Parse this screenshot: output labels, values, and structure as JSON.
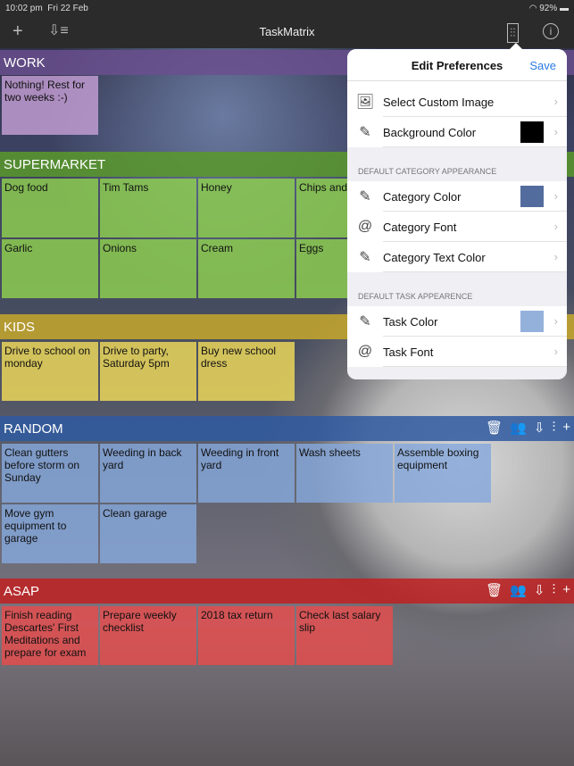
{
  "status": {
    "time": "10:02 pm",
    "date": "Fri 22 Feb",
    "battery": "92%"
  },
  "nav": {
    "title": "TaskMatrix",
    "add_icon": "plus-icon",
    "sort_icon": "sort-icon",
    "prefs_icon": "sliders-icon",
    "info_icon": "info-icon"
  },
  "categories": [
    {
      "name": "WORK",
      "color": "#6a4f8f",
      "task_color": "#c79fd6",
      "tasks": [
        "Nothing! Rest for two weeks :-)"
      ]
    },
    {
      "name": "SUPERMARKET",
      "color": "#5a9a2a",
      "task_color": "#8fd24f",
      "tasks": [
        "Dog food",
        "Tim Tams",
        "Honey",
        "Chips and",
        "Garlic",
        "Onions",
        "Cream",
        "Eggs"
      ]
    },
    {
      "name": "KIDS",
      "color": "#c8a82a",
      "task_color": "#f2dc5a",
      "tasks": [
        "Drive to school on monday",
        "Drive to party, Saturday 5pm",
        "Buy new school dress"
      ]
    },
    {
      "name": "RANDOM",
      "color": "#2f5aa0",
      "task_color": "#86a8dc",
      "tasks": [
        "Clean gutters before storm on Sunday",
        "Weeding in back yard",
        "Weeding in front yard",
        "Wash sheets",
        "Assemble boxing equipment",
        "Move gym equipment to garage",
        "Clean garage"
      ]
    },
    {
      "name": "ASAP",
      "color": "#c02020",
      "task_color": "#e84c4c",
      "tasks": [
        "Finish reading Descartes' First Meditations and prepare for exam",
        "Prepare weekly checklist",
        "2018 tax return",
        "Check last salary slip"
      ]
    }
  ],
  "category_tools": [
    "trash-icon",
    "people-icon",
    "sort-icon",
    "sliders-icon",
    "plus-icon"
  ],
  "preferences": {
    "title": "Edit Preferences",
    "save": "Save",
    "rows1": [
      {
        "label": "Select Custom Image",
        "icon": "image-icon"
      },
      {
        "label": "Background Color",
        "icon": "brush-icon",
        "swatch": "#000000"
      }
    ],
    "section2": "DEFAULT CATEGORY APPEARANCE",
    "rows2": [
      {
        "label": "Category Color",
        "icon": "brush-icon",
        "swatch": "#536c9e"
      },
      {
        "label": "Category Font",
        "icon": "at-icon"
      },
      {
        "label": "Category Text Color",
        "icon": "brush-icon"
      }
    ],
    "section3": "DEFAULT TASK APPEARENCE",
    "rows3": [
      {
        "label": "Task Color",
        "icon": "brush-icon",
        "swatch": "#94b1dc"
      },
      {
        "label": "Task Font",
        "icon": "at-icon"
      }
    ]
  }
}
